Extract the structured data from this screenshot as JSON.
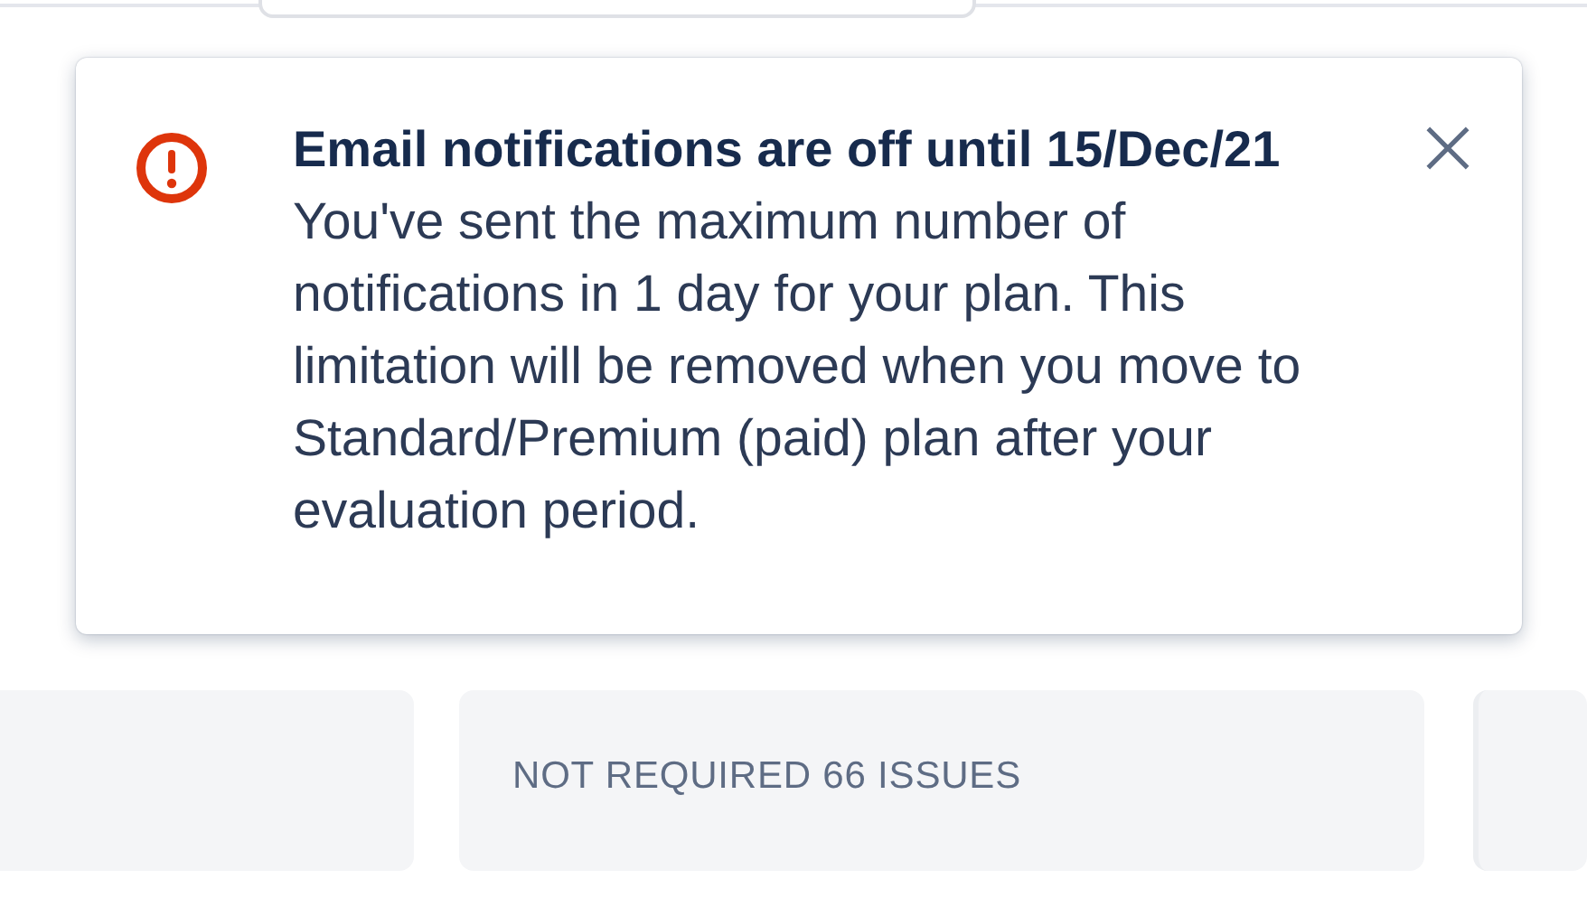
{
  "flag": {
    "kind": "error",
    "title": "Email notifications are off until 15/Dec/21",
    "body": "You've sent the maximum number of notifications in 1 day for your plan. This limitation will be removed when you move to Standard/Premium (paid) plan after your evaluation period.",
    "dismissible": true
  },
  "columns": [
    {
      "kind": "blank"
    },
    {
      "kind": "status",
      "title": "NOT REQUIRED 66 ISSUES"
    },
    {
      "kind": "blank"
    }
  ]
}
